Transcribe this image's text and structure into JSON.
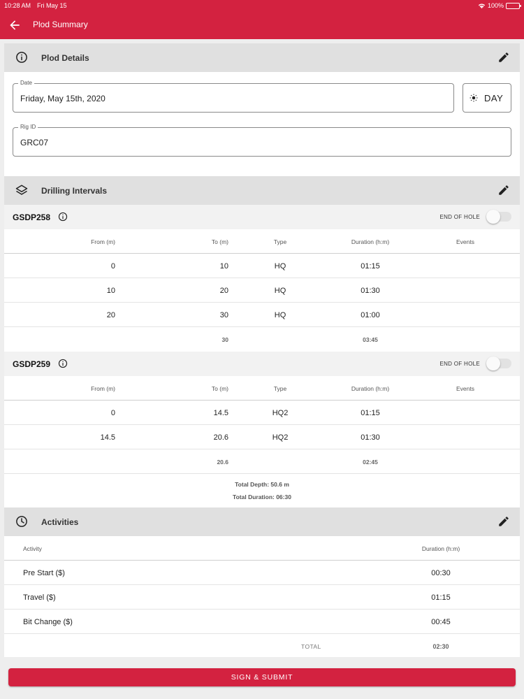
{
  "status_bar": {
    "time": "10:28 AM",
    "date": "Fri May 15",
    "battery": "100%"
  },
  "app_bar": {
    "title": "Plod Summary",
    "back_icon": "arrow-left-icon"
  },
  "plod_details": {
    "title": "Plod Details",
    "icon": "info-circle-icon",
    "date_label": "Date",
    "date_value": "Friday, May 15th, 2020",
    "shift": "DAY",
    "shift_icon": "sun-icon",
    "rig_label": "Rig ID",
    "rig_value": "GRC07"
  },
  "drilling_intervals": {
    "title": "Drilling Intervals",
    "icon": "layers-icon",
    "columns": {
      "from": "From (m)",
      "to": "To (m)",
      "type": "Type",
      "duration": "Duration (h:m)",
      "events": "Events"
    },
    "end_of_hole_label": "END OF HOLE",
    "holes": [
      {
        "name": "GSDP258",
        "end_of_hole": false,
        "rows": [
          {
            "from": "0",
            "to": "10",
            "type": "HQ",
            "duration": "01:15",
            "events": ""
          },
          {
            "from": "10",
            "to": "20",
            "type": "HQ",
            "duration": "01:30",
            "events": ""
          },
          {
            "from": "20",
            "to": "30",
            "type": "HQ",
            "duration": "01:00",
            "events": ""
          }
        ],
        "total_to": "30",
        "total_duration": "03:45"
      },
      {
        "name": "GSDP259",
        "end_of_hole": false,
        "rows": [
          {
            "from": "0",
            "to": "14.5",
            "type": "HQ2",
            "duration": "01:15",
            "events": ""
          },
          {
            "from": "14.5",
            "to": "20.6",
            "type": "HQ2",
            "duration": "01:30",
            "events": ""
          }
        ],
        "total_to": "20.6",
        "total_duration": "02:45"
      }
    ],
    "total_depth": "Total Depth: 50.6 m",
    "total_duration": "Total Duration: 06:30"
  },
  "activities": {
    "title": "Activities",
    "icon": "clock-icon",
    "col_activity": "Activity",
    "col_duration": "Duration (h:m)",
    "rows": [
      {
        "name": "Pre Start ($)",
        "duration": "00:30"
      },
      {
        "name": "Travel ($)",
        "duration": "01:15"
      },
      {
        "name": "Bit Change ($)",
        "duration": "00:45"
      }
    ],
    "total_label": "TOTAL",
    "total_duration": "02:30"
  },
  "submit_label": "SIGN & SUBMIT",
  "colors": {
    "brand": "#d32240",
    "section_bg": "#e0e0e0",
    "page_bg": "#eeeeee"
  }
}
